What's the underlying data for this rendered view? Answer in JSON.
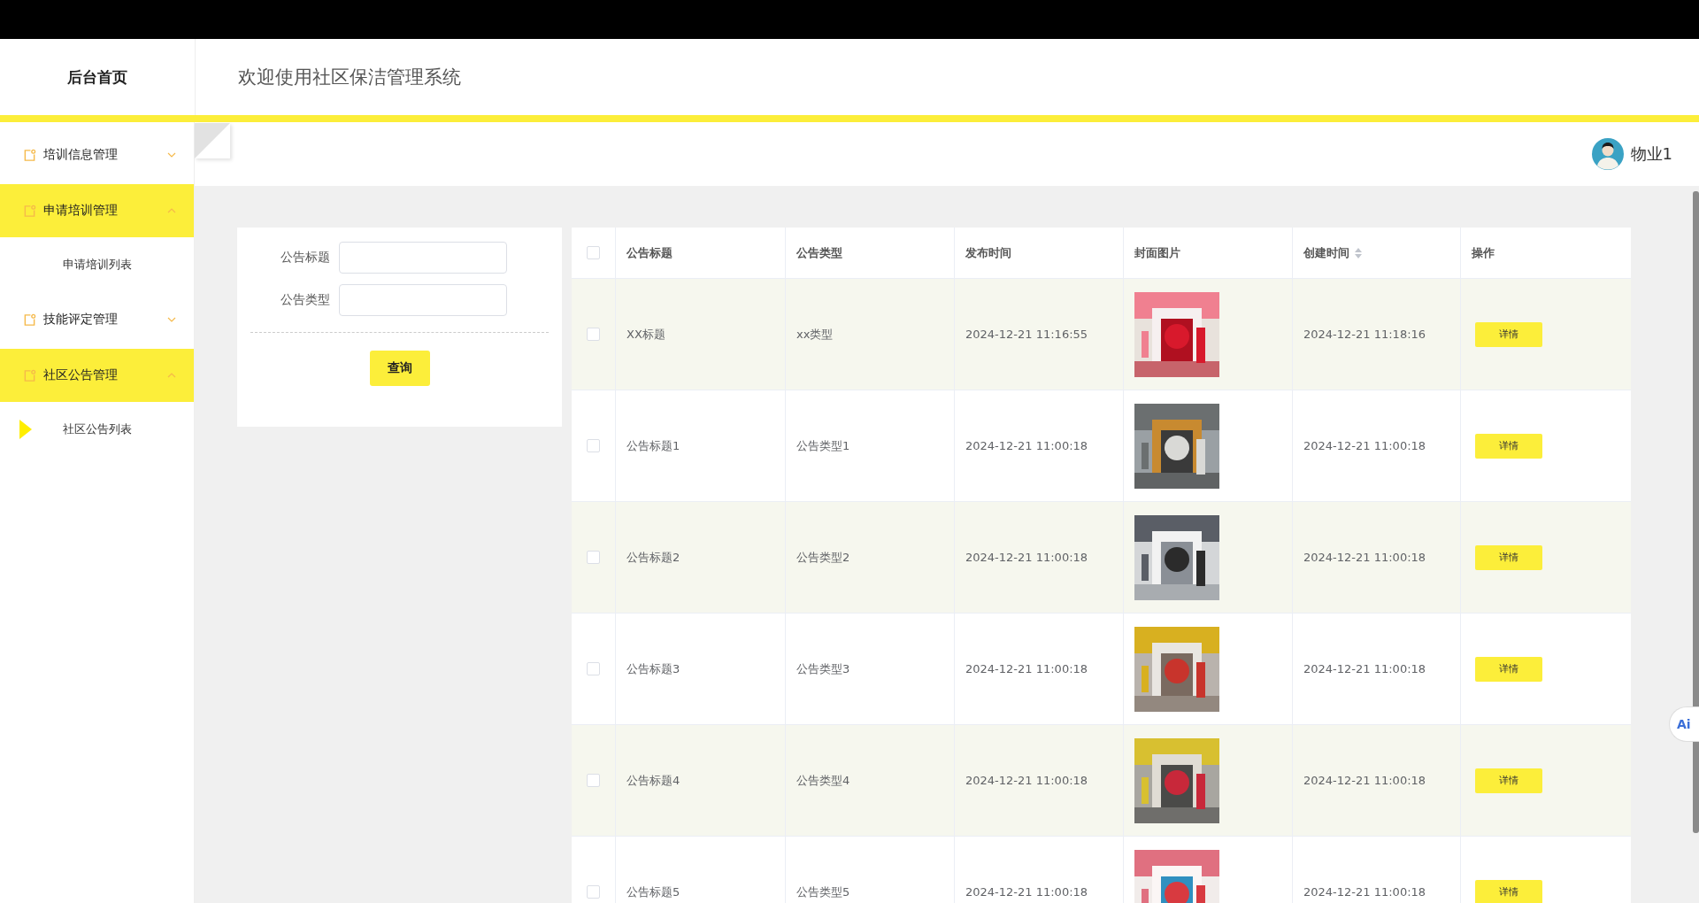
{
  "header": {
    "home_title": "后台首页",
    "welcome": "欢迎使用社区保洁管理系统"
  },
  "sidebar": {
    "items": [
      {
        "label": "培训信息管理",
        "expanded": false
      },
      {
        "label": "申请培训管理",
        "expanded": true,
        "children": [
          {
            "label": "申请培训列表",
            "selected": false
          }
        ]
      },
      {
        "label": "技能评定管理",
        "expanded": false
      },
      {
        "label": "社区公告管理",
        "expanded": true,
        "children": [
          {
            "label": "社区公告列表",
            "selected": true
          }
        ]
      }
    ]
  },
  "user": {
    "name": "物业1"
  },
  "search": {
    "fields": [
      {
        "label": "公告标题"
      },
      {
        "label": "公告类型"
      }
    ],
    "button": "查询"
  },
  "table": {
    "all_checked": false,
    "columns": [
      {
        "label": "公告标题",
        "sortable": false
      },
      {
        "label": "公告类型",
        "sortable": false
      },
      {
        "label": "发布时间",
        "sortable": false
      },
      {
        "label": "封面图片",
        "sortable": false
      },
      {
        "label": "创建时间",
        "sortable": true
      },
      {
        "label": "操作",
        "sortable": false
      }
    ],
    "rows": [
      {
        "checked": false,
        "title": "XX标题",
        "type": "xx类型",
        "published": "2024-12-21 11:16:55",
        "created": "2024-12-21 11:18:16",
        "action": "详情"
      },
      {
        "checked": false,
        "title": "公告标题1",
        "type": "公告类型1",
        "published": "2024-12-21 11:00:18",
        "created": "2024-12-21 11:00:18",
        "action": "详情"
      },
      {
        "checked": false,
        "title": "公告标题2",
        "type": "公告类型2",
        "published": "2024-12-21 11:00:18",
        "created": "2024-12-21 11:00:18",
        "action": "详情"
      },
      {
        "checked": false,
        "title": "公告标题3",
        "type": "公告类型3",
        "published": "2024-12-21 11:00:18",
        "created": "2024-12-21 11:00:18",
        "action": "详情"
      },
      {
        "checked": false,
        "title": "公告标题4",
        "type": "公告类型4",
        "published": "2024-12-21 11:00:18",
        "created": "2024-12-21 11:00:18",
        "action": "详情"
      },
      {
        "checked": false,
        "title": "公告标题5",
        "type": "公告类型5",
        "published": "2024-12-21 11:00:18",
        "created": "2024-12-21 11:00:18",
        "action": "详情"
      }
    ]
  },
  "floating_button": {
    "label": "Ai"
  }
}
